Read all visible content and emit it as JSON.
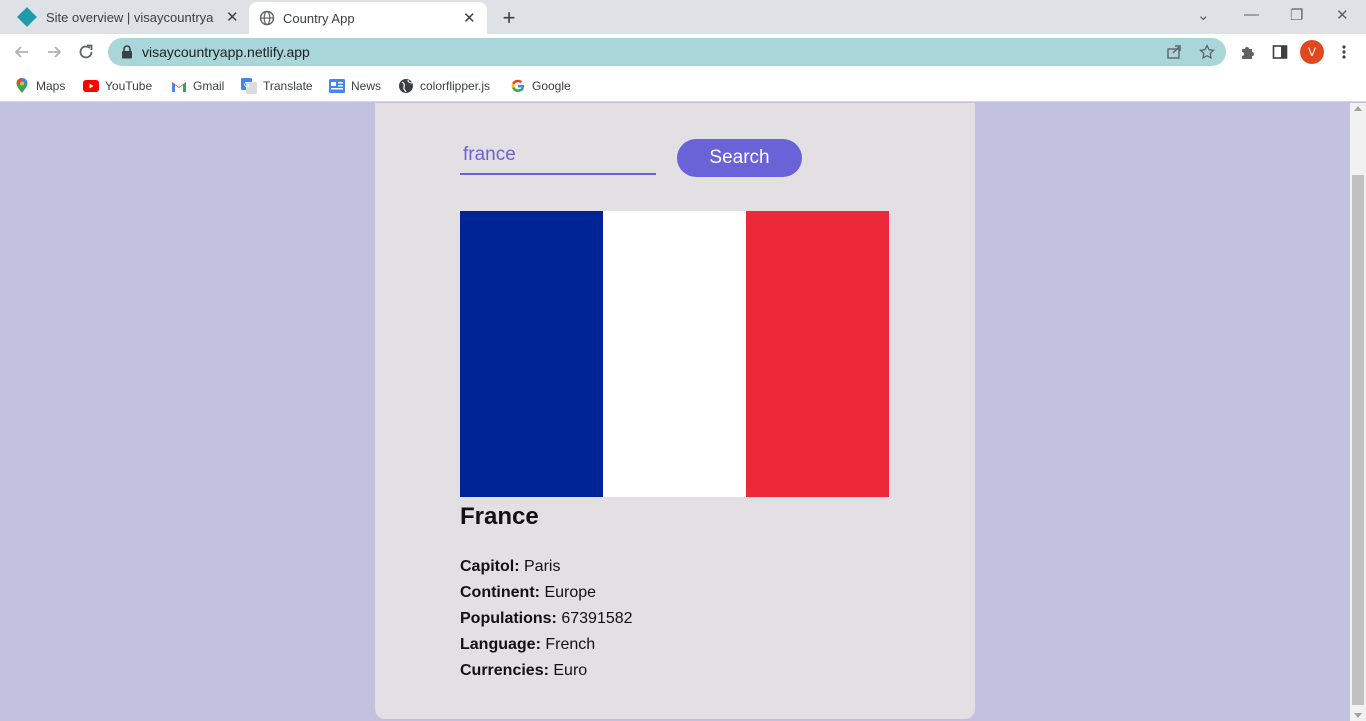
{
  "browser": {
    "tabs": [
      {
        "title": "Site overview | visaycountryapp",
        "favicon": "netlify-diamond-icon"
      },
      {
        "title": "Country App",
        "favicon": "globe-icon"
      }
    ],
    "url": "visaycountryapp.netlify.app",
    "profile_initial": "V",
    "bookmarks": [
      {
        "label": "Maps",
        "icon": "maps-pin-icon"
      },
      {
        "label": "YouTube",
        "icon": "youtube-icon"
      },
      {
        "label": "Gmail",
        "icon": "gmail-icon"
      },
      {
        "label": "Translate",
        "icon": "translate-icon"
      },
      {
        "label": "News",
        "icon": "news-icon"
      },
      {
        "label": "colorflipper.js",
        "icon": "globe-icon"
      },
      {
        "label": "Google",
        "icon": "google-icon"
      }
    ]
  },
  "app": {
    "search": {
      "value": "france",
      "button_label": "Search"
    },
    "flag_colors": [
      "#002395",
      "#ffffff",
      "#ed2939"
    ],
    "country": "France",
    "details": [
      {
        "label": "Capitol:",
        "value": "Paris"
      },
      {
        "label": "Continent:",
        "value": "Europe"
      },
      {
        "label": "Populations:",
        "value": "67391582"
      },
      {
        "label": "Language:",
        "value": "French"
      },
      {
        "label": "Currencies:",
        "value": "Euro"
      }
    ]
  },
  "colors": {
    "accent": "#6a63d8",
    "page_background": "#c4c0e0",
    "card_background": "#e3e0e4",
    "omnibox": "#a9d6d8"
  }
}
